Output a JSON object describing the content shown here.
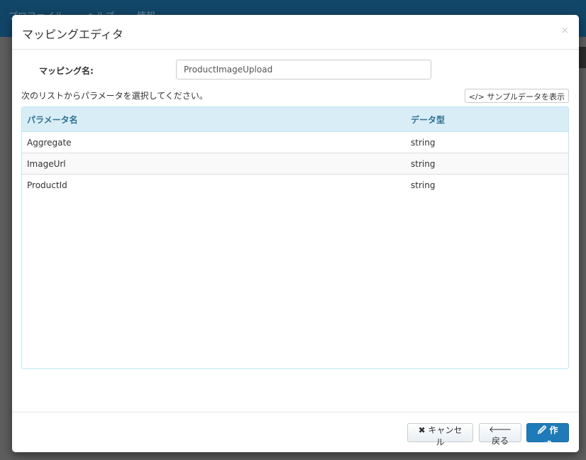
{
  "nav": [
    "プロファイル",
    "ヘルプ",
    "情報"
  ],
  "modal": {
    "title": "マッピングエディタ",
    "close": "×",
    "mapping_label": "マッピング名:",
    "mapping_value": "ProductImageUpload",
    "hint": "次のリストからパラメータを選択してください。",
    "sample_button": "</> サンプルデータを表示",
    "columns": [
      "パラメータ名",
      "データ型"
    ],
    "rows": [
      [
        "Aggregate",
        "string"
      ],
      [
        "ImageUrl",
        "string"
      ],
      [
        "ProductId",
        "string"
      ]
    ],
    "cancel": "✖ キャンセル",
    "back": "🡐 戻る",
    "create": "🖉 作成"
  }
}
